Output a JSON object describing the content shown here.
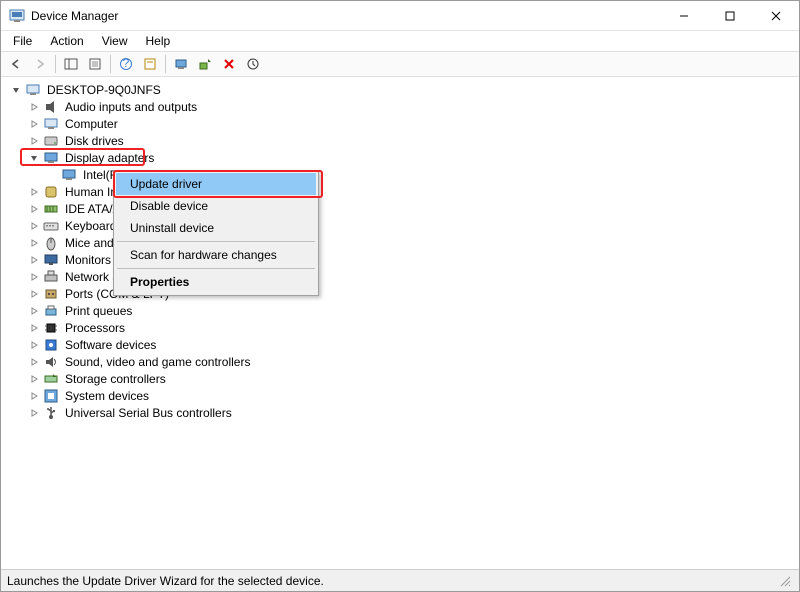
{
  "window": {
    "title": "Device Manager"
  },
  "menubar": [
    "File",
    "Action",
    "View",
    "Help"
  ],
  "tree": {
    "root": "DESKTOP-9Q0JNFS",
    "items": [
      {
        "label": "Audio inputs and outputs",
        "icon": "audio"
      },
      {
        "label": "Computer",
        "icon": "computer"
      },
      {
        "label": "Disk drives",
        "icon": "disk"
      },
      {
        "label": "Display adapters",
        "icon": "display",
        "expanded": true,
        "children": [
          {
            "label": "Intel(R) HD Graphics 4600",
            "icon": "display"
          }
        ]
      },
      {
        "label": "Human Interface Devices",
        "icon": "hid"
      },
      {
        "label": "IDE ATA/ATAPI controllers",
        "icon": "ide"
      },
      {
        "label": "Keyboards",
        "icon": "keyboard"
      },
      {
        "label": "Mice and other pointing devices",
        "icon": "mouse"
      },
      {
        "label": "Monitors",
        "icon": "monitor"
      },
      {
        "label": "Network adapters",
        "icon": "network"
      },
      {
        "label": "Ports (COM & LPT)",
        "icon": "ports"
      },
      {
        "label": "Print queues",
        "icon": "printer"
      },
      {
        "label": "Processors",
        "icon": "cpu"
      },
      {
        "label": "Software devices",
        "icon": "software"
      },
      {
        "label": "Sound, video and game controllers",
        "icon": "sound"
      },
      {
        "label": "Storage controllers",
        "icon": "storage"
      },
      {
        "label": "System devices",
        "icon": "system"
      },
      {
        "label": "Universal Serial Bus controllers",
        "icon": "usb"
      }
    ]
  },
  "context_menu": {
    "items": [
      {
        "label": "Update driver",
        "selected": true
      },
      {
        "label": "Disable device"
      },
      {
        "label": "Uninstall device"
      },
      {
        "sep": true
      },
      {
        "label": "Scan for hardware changes"
      },
      {
        "sep": true
      },
      {
        "label": "Properties",
        "bold": true
      }
    ]
  },
  "status": "Launches the Update Driver Wizard for the selected device."
}
